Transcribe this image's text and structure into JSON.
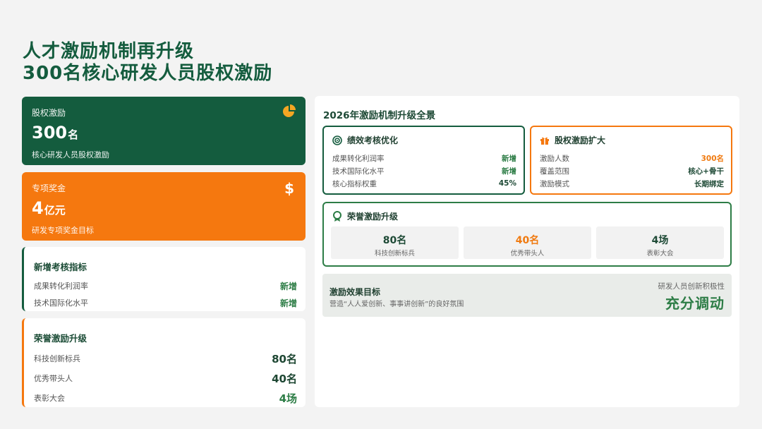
{
  "title": {
    "line1": "人才激励机制再升级",
    "line2": "300名核心研发人员股权激励"
  },
  "equity_card": {
    "label": "股权激励",
    "value": "300",
    "unit": "名",
    "sub": "核心研发人员股权激励",
    "icon": "pie-chart-icon",
    "color": "#145c3e"
  },
  "bonus_card": {
    "label": "专项奖金",
    "value": "4",
    "unit": "亿元",
    "sub": "研发专项奖金目标",
    "icon": "dollar-icon",
    "color": "#f5780f"
  },
  "kpi_card": {
    "title": "新增考核指标",
    "rows": [
      {
        "label": "成果转化利润率",
        "value": "新增"
      },
      {
        "label": "技术国际化水平",
        "value": "新增"
      }
    ]
  },
  "honor_card": {
    "title": "荣誉激励升级",
    "rows": [
      {
        "label": "科技创新标兵",
        "value": "80名"
      },
      {
        "label": "优秀带头人",
        "value": "40名"
      },
      {
        "label": "表彰大会",
        "value": "4场"
      }
    ]
  },
  "panel": {
    "title": "2026年激励机制升级全景",
    "perf": {
      "title": "绩效考核优化",
      "icon": "target-icon",
      "rows": [
        {
          "label": "成果转化利润率",
          "value": "新增"
        },
        {
          "label": "技术国际化水平",
          "value": "新增"
        },
        {
          "label": "核心指标权重",
          "value": "45%"
        }
      ]
    },
    "equity": {
      "title": "股权激励扩大",
      "icon": "gift-icon",
      "rows": [
        {
          "label": "激励人数",
          "value": "300名"
        },
        {
          "label": "覆盖范围",
          "value": "核心+骨干"
        },
        {
          "label": "激励模式",
          "value": "长期绑定"
        }
      ]
    },
    "honor": {
      "title": "荣誉激励升级",
      "icon": "award-icon",
      "tiles": [
        {
          "value": "80名",
          "label": "科技创新标兵"
        },
        {
          "value": "40名",
          "label": "优秀带头人"
        },
        {
          "value": "4场",
          "label": "表彰大会"
        }
      ]
    },
    "effect": {
      "title": "激励效果目标",
      "desc": "营造“人人爱创新、事事讲创新”的良好氛围",
      "note": "研发人员创新积极性",
      "big": "充分调动"
    }
  },
  "colors": {
    "green": "#145c3e",
    "orange": "#f5780f",
    "accent_green": "#2d7d46"
  }
}
